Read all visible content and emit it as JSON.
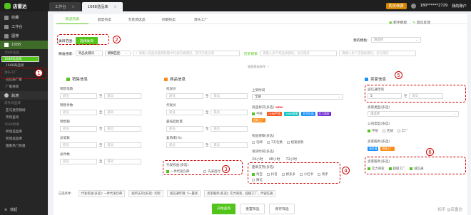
{
  "app": {
    "name": "店雷达"
  },
  "topbar": {
    "tabs": [
      {
        "label": "工作台"
      },
      {
        "label": "1688选品库"
      }
    ],
    "vip_label": "购买续费",
    "phone": "180******2729",
    "user_menu": "我的账户"
  },
  "sidebar": {
    "items": [
      {
        "label": "收藏"
      },
      {
        "label": "工作台"
      },
      {
        "label": "图搜"
      }
    ],
    "group_1688": "1688",
    "sub_1688_head": "1688选品",
    "sub_1688": [
      "1688选品库",
      "1688商品榜"
    ],
    "sub_factory_head": "源头工厂",
    "sub_factory": [
      "找优质厂家",
      "厂家榜单"
    ],
    "group_kuajing": "跨境",
    "sub_kj_head": "海外商品库",
    "sub_kj": [
      "亚马逊热销榜",
      "专利查询"
    ],
    "sub_kj2_head": "1688跨境",
    "sub_kj2": [
      "跨境选品库",
      "跨境选品库",
      "国家热门货盘"
    ],
    "collapse": "收起"
  },
  "subtabs": [
    "新品热卖",
    "趋势热卖",
    "无货源选品",
    "同期热卖",
    "源头工厂"
  ],
  "category": {
    "label": "类目范围:",
    "button": "选择类目"
  },
  "right_links": {
    "template_label": "我的模板:",
    "template_placeholder": "请选择"
  },
  "newbie": "新手教程",
  "feedback": "意见反馈",
  "search": {
    "label": "精准搜索:",
    "sel1": "商品关键词",
    "sel2": "模糊匹配",
    "placeholder": "请输入商品标题或标题中包含的关键词，支持空格分隔",
    "history": "历史搜索",
    "ph2": "请输入多个商品关键词，逗号隔开",
    "ph3": "请输入多个店铺关键词，逗号隔开"
  },
  "collapse_filter": "收起筛选条件",
  "sections": {
    "sales": "销售信息",
    "product": "商品信息",
    "seller": "卖家信息"
  },
  "sales_fields": [
    "销售笔数",
    "销售件数",
    "销售额",
    "总笔数",
    "总件数"
  ],
  "product_fields": [
    "批发价",
    "代发价",
    "最低起批量",
    "复购率(%)"
  ],
  "middle_fields": {
    "shelf_time": "上架时间",
    "shelf_value": "全部",
    "tags": "商品标识(多选)",
    "guarantee": "权益保障(多选)",
    "ship_time": "发货时间(多选)",
    "ship_options": [
      "24小时",
      "48小时",
      "72小时"
    ],
    "return": "7天包换",
    "free": "包邮",
    "refund": "极速退款",
    "source_support": "面单支持(多选)",
    "source_options": [
      "淘宝",
      "抖音",
      "拼多多",
      "小红书",
      "快手",
      "微信"
    ]
  },
  "tags": [
    {
      "label": "不限",
      "color": "#52c41a"
    },
    {
      "label": "1688严选",
      "color": "#fa541c"
    },
    {
      "label": "1688跨境",
      "color": "#13c2c2"
    },
    {
      "label": "官方优选",
      "color": "#1890ff"
    },
    {
      "label": "实力商家",
      "color": "#722ed1"
    },
    {
      "label": "超级工厂",
      "color": "#fa8c16"
    }
  ],
  "seller_fields": {
    "years": "诚信通年限",
    "years_value": "5",
    "years_placeholder": "最高",
    "type": "卖家类型(多选)",
    "type_placeholder": "请选择",
    "company": "公司类型(多选)",
    "company_options": [
      "不限",
      "店铺",
      "工厂"
    ],
    "service": "卖家服务(多选)",
    "service_options": [
      "实力商家",
      "超级工厂",
      "诚信通"
    ],
    "credit_option": "诚信通"
  },
  "selected_filters": {
    "label": "已选条件:",
    "items": [
      "代发权益(多选): 一件代发包邮",
      "面单支持(多选): 淘宝",
      "诚信通年限: 5~最高",
      "卖家服务(多选): 实力商家，超级工厂，传诚信通"
    ]
  },
  "proxy": {
    "label": "代发权益(多选)",
    "opt1": "一件代发包邮",
    "opt2": "先采后付"
  },
  "annotations": [
    "1",
    "2",
    "3",
    "4",
    "5",
    "6"
  ],
  "bottom_buttons": {
    "search": "开始查询",
    "reset": "重置筛选",
    "save": "保存筛选"
  },
  "watermark": "知乎 @店雷达",
  "colors": {
    "accent": "#52c41a",
    "annotation": "#cc0000",
    "section_green": "#52c41a",
    "section_orange": "#fa8c16",
    "section_blue": "#1890ff"
  },
  "placeholders": {
    "min": "最低",
    "max": "最高",
    "to": "至"
  }
}
